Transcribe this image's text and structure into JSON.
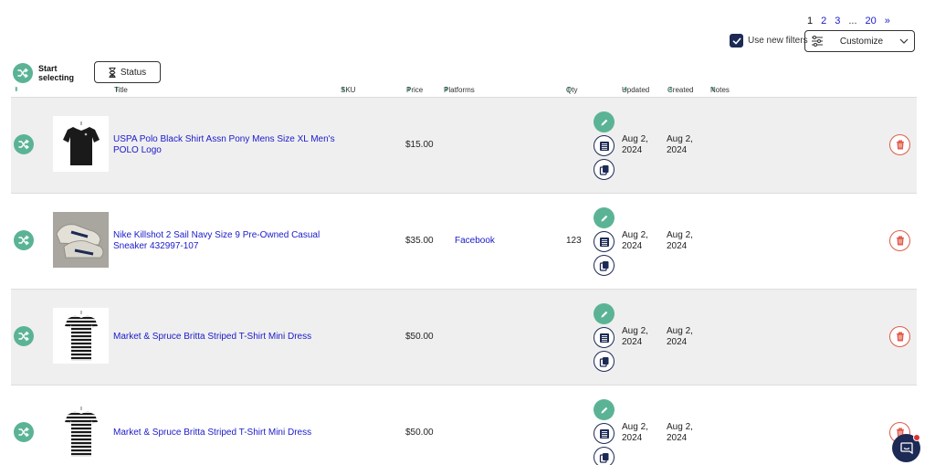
{
  "pagination": {
    "pages": [
      "1",
      "2",
      "3",
      "...",
      "20",
      "»"
    ],
    "current": "1"
  },
  "filters": {
    "use_new_filters_label": "Use new filters",
    "use_new_filters_checked": true,
    "customize_label": "Customize"
  },
  "toolbar": {
    "start_selecting_label": "Start selecting",
    "status_label": "Status"
  },
  "columns": {
    "title": "Title",
    "sku": "SKU",
    "price": "Price",
    "platforms": "Platforms",
    "qty": "Qty",
    "updated": "Updated",
    "created": "Created",
    "notes": "Notes"
  },
  "rows": [
    {
      "title": "USPA Polo Black Shirt Assn Pony Mens Size XL Men's POLO Logo",
      "price": "$15.00",
      "platform": "",
      "qty": "",
      "updated": "Aug 2, 2024",
      "created": "Aug 2, 2024",
      "thumb": "black-shirt"
    },
    {
      "title": "Nike Killshot 2 Sail Navy Size 9 Pre-Owned Casual Sneaker 432997-107",
      "price": "$35.00",
      "platform": "Facebook",
      "qty": "123",
      "updated": "Aug 2, 2024",
      "created": "Aug 2, 2024",
      "thumb": "sneaker"
    },
    {
      "title": "Market & Spruce Britta Striped T-Shirt Mini Dress",
      "price": "$50.00",
      "platform": "",
      "qty": "",
      "updated": "Aug 2, 2024",
      "created": "Aug 2, 2024",
      "thumb": "striped-dress"
    },
    {
      "title": "Market & Spruce Britta Striped T-Shirt Mini Dress",
      "price": "$50.00",
      "platform": "",
      "qty": "",
      "updated": "Aug 2, 2024",
      "created": "Aug 2, 2024",
      "thumb": "striped-dress"
    }
  ],
  "colors": {
    "accent_green": "#5bb395",
    "navy": "#1d2a55",
    "link_blue": "#1a1acb",
    "delete_red": "#e05a4a",
    "row_gray": "#efefef"
  }
}
